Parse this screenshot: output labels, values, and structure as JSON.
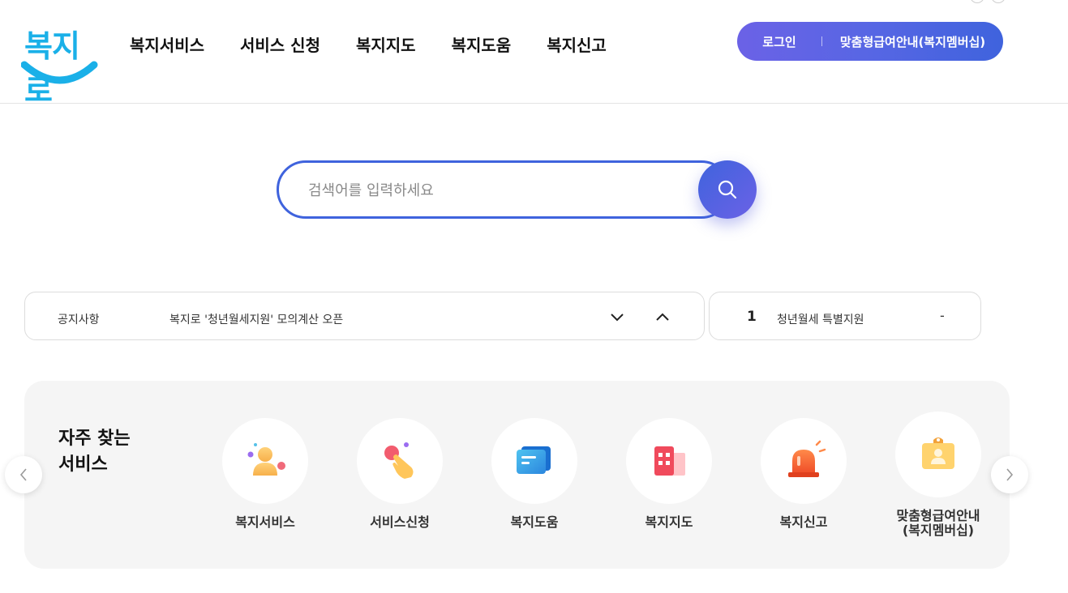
{
  "header": {
    "logo_text": "복지로",
    "nav": [
      "복지서비스",
      "서비스 신청",
      "복지지도",
      "복지도움",
      "복지신고"
    ],
    "login_label": "로그인",
    "member_label": "맞춤형급여안내(복지멤버십)"
  },
  "search": {
    "placeholder": "검색어를 입력하세요"
  },
  "notice": {
    "label": "공지사항",
    "text": "복지로 '청년월세지원' 모의계산 오픈"
  },
  "ranking": {
    "rank": "1",
    "keyword": "청년월세 특별지원",
    "change": "-"
  },
  "frequent": {
    "title_line1": "자주 찾는",
    "title_line2": "서비스",
    "items": [
      {
        "label": "복지서비스",
        "icon": "person-icon"
      },
      {
        "label": "서비스신청",
        "icon": "hand-tap-icon"
      },
      {
        "label": "복지도움",
        "icon": "message-icon"
      },
      {
        "label": "복지지도",
        "icon": "building-icon"
      },
      {
        "label": "복지신고",
        "icon": "siren-icon"
      },
      {
        "label_line1": "맞춤형급여안내",
        "label_line2": "(복지멤버십)",
        "icon": "id-badge-icon"
      }
    ]
  },
  "colors": {
    "brand_blue": "#3f63dd",
    "brand_purple": "#6b62e6",
    "logo_cyan": "#1ab0e8"
  }
}
